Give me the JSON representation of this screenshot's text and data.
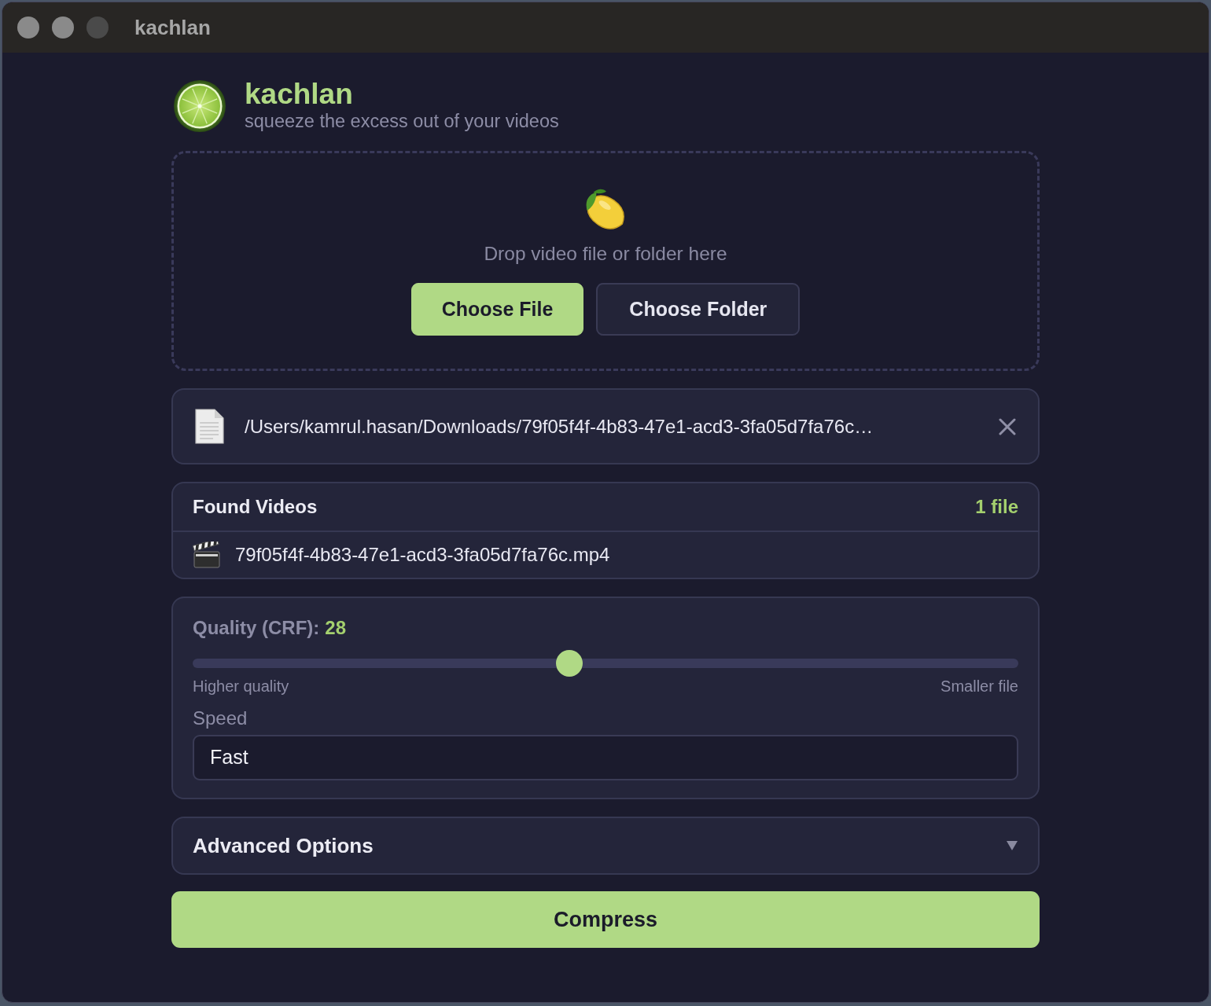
{
  "window": {
    "title": "kachlan"
  },
  "header": {
    "title": "kachlan",
    "subtitle": "squeeze the excess out of your videos"
  },
  "drop_zone": {
    "prompt": "Drop video file or folder here",
    "buttons": [
      {
        "label": "Choose File",
        "kind": "primary"
      },
      {
        "label": "Choose Folder",
        "kind": "secondary"
      }
    ]
  },
  "selected_path": {
    "path": "/Users/kamrul.hasan/Downloads/79f05f4f-4b83-47e1-acd3-3fa05d7fa76c…"
  },
  "found_videos": {
    "title": "Found Videos",
    "count": "1 file",
    "files": [
      {
        "name": "79f05f4f-4b83-47e1-acd3-3fa05d7fa76c.mp4"
      }
    ]
  },
  "quality": {
    "label": "Quality (CRF):",
    "value": "28",
    "level": 0.456,
    "min_label": "Higher quality",
    "max_label": "Smaller file"
  },
  "speed": {
    "label": "Speed",
    "value": "Fast"
  },
  "advanced_options": {
    "label": "Advanced Options",
    "expanded": false
  },
  "compress_button": {
    "label": "Compress"
  }
}
